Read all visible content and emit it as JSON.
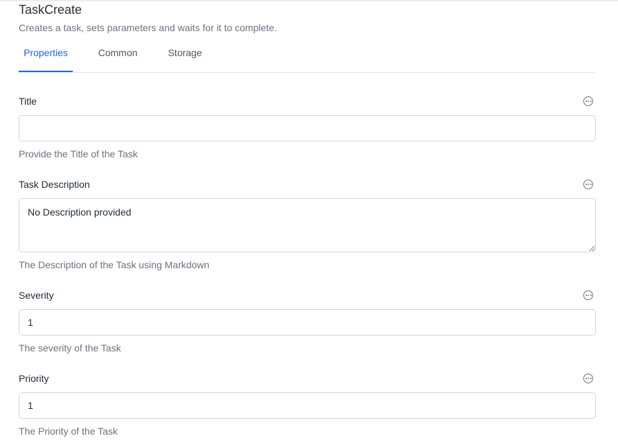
{
  "header": {
    "title": "TaskCreate",
    "subtitle": "Creates a task, sets parameters and waits for it to complete."
  },
  "tabs": [
    {
      "label": "Properties",
      "active": true
    },
    {
      "label": "Common",
      "active": false
    },
    {
      "label": "Storage",
      "active": false
    }
  ],
  "fields": {
    "title": {
      "label": "Title",
      "value": "",
      "help": "Provide the Title of the Task"
    },
    "description": {
      "label": "Task Description",
      "value": "No Description provided",
      "help": "The Description of the Task using Markdown"
    },
    "severity": {
      "label": "Severity",
      "value": "1",
      "help": "The severity of the Task"
    },
    "priority": {
      "label": "Priority",
      "value": "1",
      "help": "The Priority of the Task"
    }
  },
  "icons": {
    "field_menu": "more-horizontal-circle-icon"
  },
  "colors": {
    "accent": "#2563eb",
    "text": "#1f2937",
    "muted": "#6b7280",
    "border": "#d1d5db"
  }
}
